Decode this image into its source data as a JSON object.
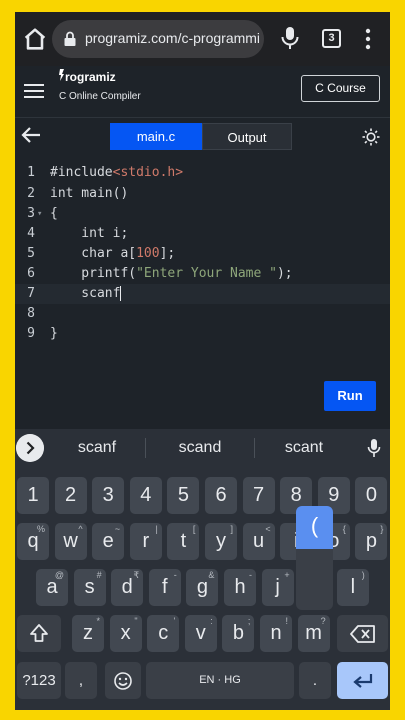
{
  "browser": {
    "url": "programiz.com/c-programming",
    "tab_count": "3"
  },
  "header": {
    "logo_text": "rogramiz",
    "subtitle": "C Online Compiler",
    "course_button": "C Course"
  },
  "toolbar": {
    "tabs": [
      {
        "label": "main.c",
        "active": true
      },
      {
        "label": "Output",
        "active": false
      }
    ]
  },
  "editor": {
    "lines": [
      {
        "num": "1",
        "text": "#include<stdio.h>"
      },
      {
        "num": "2",
        "text": "int main()"
      },
      {
        "num": "3",
        "text": "{"
      },
      {
        "num": "4",
        "text": "    int i;"
      },
      {
        "num": "5",
        "text": "    char a[100];"
      },
      {
        "num": "6",
        "text": "    printf(\"Enter Your Name \");"
      },
      {
        "num": "7",
        "text": "    scanf"
      },
      {
        "num": "8",
        "text": ""
      },
      {
        "num": "9",
        "text": "}"
      }
    ],
    "run_label": "Run"
  },
  "keyboard": {
    "suggestions": [
      "scanf",
      "scand",
      "scant"
    ],
    "row_numbers": [
      "1",
      "2",
      "3",
      "4",
      "5",
      "6",
      "7",
      "8",
      "9",
      "0"
    ],
    "row_q": [
      {
        "k": "q",
        "h": "%"
      },
      {
        "k": "w",
        "h": "^"
      },
      {
        "k": "e",
        "h": "~"
      },
      {
        "k": "r",
        "h": "|"
      },
      {
        "k": "t",
        "h": "["
      },
      {
        "k": "y",
        "h": "]"
      },
      {
        "k": "u",
        "h": "<"
      },
      {
        "k": "i",
        "h": ">"
      },
      {
        "k": "o",
        "h": "{"
      },
      {
        "k": "p",
        "h": "}"
      }
    ],
    "row_a": [
      {
        "k": "a",
        "h": "@"
      },
      {
        "k": "s",
        "h": "#"
      },
      {
        "k": "d",
        "h": "₹"
      },
      {
        "k": "f",
        "h": "-"
      },
      {
        "k": "g",
        "h": "&"
      },
      {
        "k": "h",
        "h": "-"
      },
      {
        "k": "j",
        "h": "+"
      },
      {
        "k": "k",
        "h": "("
      },
      {
        "k": "l",
        "h": ")"
      }
    ],
    "row_z": [
      {
        "k": "z",
        "h": "*"
      },
      {
        "k": "x",
        "h": "\""
      },
      {
        "k": "c",
        "h": "'"
      },
      {
        "k": "v",
        "h": ":"
      },
      {
        "k": "b",
        "h": ";"
      },
      {
        "k": "n",
        "h": "!"
      },
      {
        "k": "m",
        "h": "?"
      }
    ],
    "sym_label": "?123",
    "comma": ",",
    "space_label": "EN · HG",
    "period": ".",
    "popup_char": "("
  },
  "colors": {
    "accent": "#0556f3",
    "frame": "#f9d500",
    "enter_key": "#a8c7fa"
  }
}
